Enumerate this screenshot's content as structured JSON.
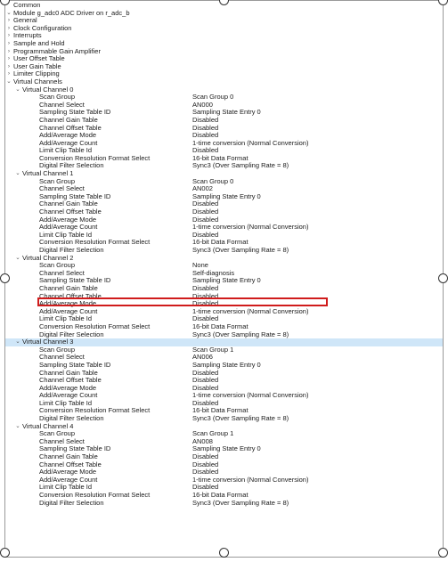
{
  "tree": [
    {
      "level": 0,
      "chev": "none",
      "label": "Common"
    },
    {
      "level": 0,
      "chev": "open",
      "label": "Module g_adc0 ADC Driver on r_adc_b"
    },
    {
      "level": 1,
      "chev": "closed",
      "label": "General"
    },
    {
      "level": 1,
      "chev": "closed",
      "label": "Clock Configuration"
    },
    {
      "level": 1,
      "chev": "closed",
      "label": "Interrupts"
    },
    {
      "level": 1,
      "chev": "closed",
      "label": "Sample and Hold"
    },
    {
      "level": 1,
      "chev": "closed",
      "label": "Programmable Gain Amplifier"
    },
    {
      "level": 1,
      "chev": "closed",
      "label": "User Offset Table"
    },
    {
      "level": 1,
      "chev": "closed",
      "label": "User Gain Table"
    },
    {
      "level": 1,
      "chev": "closed",
      "label": "Limiter Clipping"
    },
    {
      "level": 1,
      "chev": "open",
      "label": "Virtual Channels"
    },
    {
      "level": 2,
      "chev": "open",
      "label": "Virtual Channel 0"
    },
    {
      "level": 3,
      "label": "Scan Group",
      "value": "Scan Group 0"
    },
    {
      "level": 3,
      "label": "Channel Select",
      "value": "AN000"
    },
    {
      "level": 3,
      "label": "Sampling State Table ID",
      "value": "Sampling State Entry 0"
    },
    {
      "level": 3,
      "label": "Channel Gain Table",
      "value": "Disabled"
    },
    {
      "level": 3,
      "label": "Channel Offset Table",
      "value": "Disabled"
    },
    {
      "level": 3,
      "label": "Add/Average Mode",
      "value": "Disabled"
    },
    {
      "level": 3,
      "label": "Add/Average Count",
      "value": "1-time conversion (Normal Conversion)"
    },
    {
      "level": 3,
      "label": "Limit Clip Table Id",
      "value": "Disabled"
    },
    {
      "level": 3,
      "label": "Conversion Resolution Format Select",
      "value": "16-bit Data Format"
    },
    {
      "level": 3,
      "label": "Digital Filter Selection",
      "value": "Sync3 (Over Sampling Rate = 8)"
    },
    {
      "level": 2,
      "chev": "open",
      "label": "Virtual Channel 1"
    },
    {
      "level": 3,
      "label": "Scan Group",
      "value": "Scan Group 0"
    },
    {
      "level": 3,
      "label": "Channel Select",
      "value": "AN002"
    },
    {
      "level": 3,
      "label": "Sampling State Table ID",
      "value": "Sampling State Entry 0"
    },
    {
      "level": 3,
      "label": "Channel Gain Table",
      "value": "Disabled"
    },
    {
      "level": 3,
      "label": "Channel Offset Table",
      "value": "Disabled"
    },
    {
      "level": 3,
      "label": "Add/Average Mode",
      "value": "Disabled"
    },
    {
      "level": 3,
      "label": "Add/Average Count",
      "value": "1-time conversion (Normal Conversion)"
    },
    {
      "level": 3,
      "label": "Limit Clip Table Id",
      "value": "Disabled"
    },
    {
      "level": 3,
      "label": "Conversion Resolution Format Select",
      "value": "16-bit Data Format"
    },
    {
      "level": 3,
      "label": "Digital Filter Selection",
      "value": "Sync3 (Over Sampling Rate = 8)"
    },
    {
      "level": 2,
      "chev": "open",
      "label": "Virtual Channel 2"
    },
    {
      "level": 3,
      "label": "Scan Group",
      "value": "None"
    },
    {
      "level": 3,
      "label": "Channel Select",
      "value": "Self-diagnosis",
      "highlight": true
    },
    {
      "level": 3,
      "label": "Sampling State Table ID",
      "value": "Sampling State Entry 0"
    },
    {
      "level": 3,
      "label": "Channel Gain Table",
      "value": "Disabled"
    },
    {
      "level": 3,
      "label": "Channel Offset Table",
      "value": "Disabled"
    },
    {
      "level": 3,
      "label": "Add/Average Mode",
      "value": "Disabled"
    },
    {
      "level": 3,
      "label": "Add/Average Count",
      "value": "1-time conversion (Normal Conversion)"
    },
    {
      "level": 3,
      "label": "Limit Clip Table Id",
      "value": "Disabled"
    },
    {
      "level": 3,
      "label": "Conversion Resolution Format Select",
      "value": "16-bit Data Format"
    },
    {
      "level": 3,
      "label": "Digital Filter Selection",
      "value": "Sync3 (Over Sampling Rate = 8)"
    },
    {
      "level": 2,
      "chev": "open",
      "label": "Virtual Channel 3",
      "selected": true
    },
    {
      "level": 3,
      "label": "Scan Group",
      "value": "Scan Group 1"
    },
    {
      "level": 3,
      "label": "Channel Select",
      "value": "AN006"
    },
    {
      "level": 3,
      "label": "Sampling State Table ID",
      "value": "Sampling State Entry 0"
    },
    {
      "level": 3,
      "label": "Channel Gain Table",
      "value": "Disabled"
    },
    {
      "level": 3,
      "label": "Channel Offset Table",
      "value": "Disabled"
    },
    {
      "level": 3,
      "label": "Add/Average Mode",
      "value": "Disabled"
    },
    {
      "level": 3,
      "label": "Add/Average Count",
      "value": "1-time conversion (Normal Conversion)"
    },
    {
      "level": 3,
      "label": "Limit Clip Table Id",
      "value": "Disabled"
    },
    {
      "level": 3,
      "label": "Conversion Resolution Format Select",
      "value": "16-bit Data Format"
    },
    {
      "level": 3,
      "label": "Digital Filter Selection",
      "value": "Sync3 (Over Sampling Rate = 8)"
    },
    {
      "level": 2,
      "chev": "open",
      "label": "Virtual Channel 4"
    },
    {
      "level": 3,
      "label": "Scan Group",
      "value": "Scan Group 1"
    },
    {
      "level": 3,
      "label": "Channel Select",
      "value": "AN008"
    },
    {
      "level": 3,
      "label": "Sampling State Table ID",
      "value": "Sampling State Entry 0"
    },
    {
      "level": 3,
      "label": "Channel Gain Table",
      "value": "Disabled"
    },
    {
      "level": 3,
      "label": "Channel Offset Table",
      "value": "Disabled"
    },
    {
      "level": 3,
      "label": "Add/Average Mode",
      "value": "Disabled"
    },
    {
      "level": 3,
      "label": "Add/Average Count",
      "value": "1-time conversion (Normal Conversion)"
    },
    {
      "level": 3,
      "label": "Limit Clip Table Id",
      "value": "Disabled"
    },
    {
      "level": 3,
      "label": "Conversion Resolution Format Select",
      "value": "16-bit Data Format"
    },
    {
      "level": 3,
      "label": "Digital Filter Selection",
      "value": "Sync3 (Over Sampling Rate = 8)"
    }
  ],
  "icons": {
    "expanded": "chevron-down-icon",
    "collapsed": "chevron-right-icon",
    "resize": "resize-handle"
  },
  "colors": {
    "selection": "#cfe6f8",
    "highlight_box": "#d01c1c",
    "border": "#9a9a9a"
  }
}
